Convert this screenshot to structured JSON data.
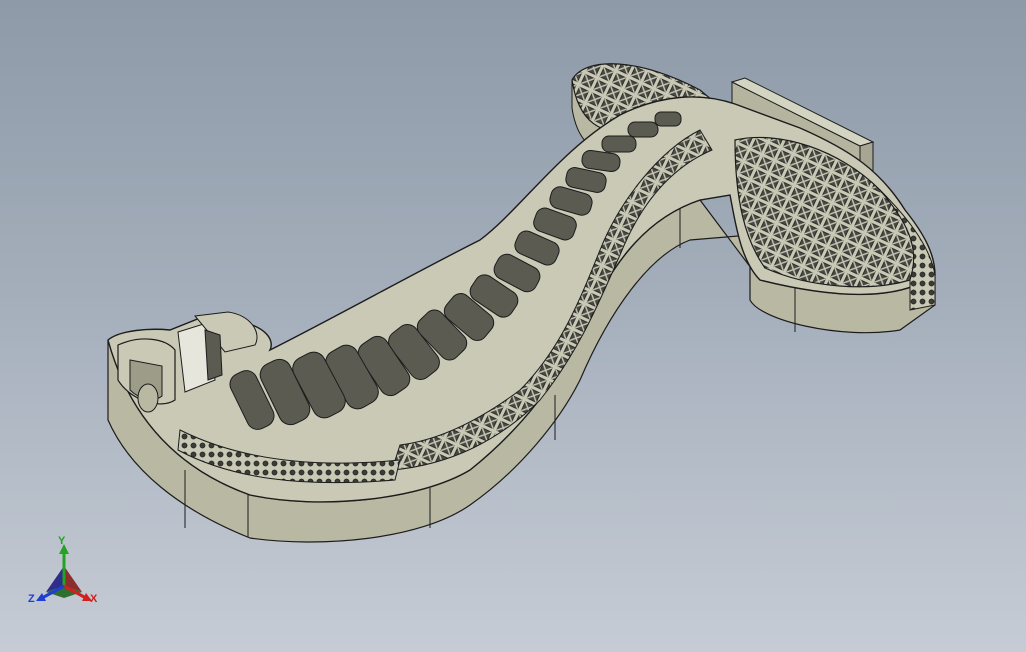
{
  "viewport": {
    "background_top": "#8e9aa8",
    "background_bottom": "#c6ccd5"
  },
  "model": {
    "icon": "lattice-heel-part",
    "face_color": "#c9c9b6",
    "side_color": "#b8b8a3",
    "edge_color": "#1c1c1c"
  },
  "triad": {
    "x_label": "X",
    "y_label": "Y",
    "z_label": "Z",
    "x_color": "#d21f1f",
    "y_color": "#23a323",
    "z_color": "#1f3fd2"
  }
}
